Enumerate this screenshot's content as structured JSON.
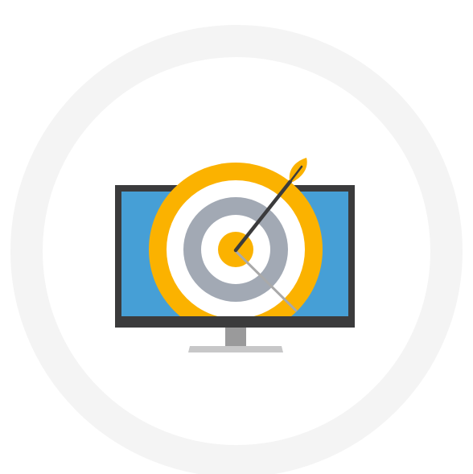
{
  "colors": {
    "background": "#ffffff",
    "ring": "#f4f4f4",
    "monitor_bezel": "#3b3b3c",
    "monitor_screen": "#469fd6",
    "monitor_stand_neck": "#9a9a9b",
    "monitor_stand_base": "#c7c7c8",
    "target_outer": "#fbb200",
    "target_white": "#ffffff",
    "target_gray": "#a2a9b4",
    "target_bullseye": "#fbb200",
    "arrow_shaft": "#3b3b3c",
    "arrow_shadow": "#a9a9a9",
    "arrow_fletching": "#fbb200"
  },
  "icons": {
    "ring": "background-ring",
    "monitor": "monitor-icon",
    "target": "target-icon",
    "arrow": "arrow-icon"
  }
}
